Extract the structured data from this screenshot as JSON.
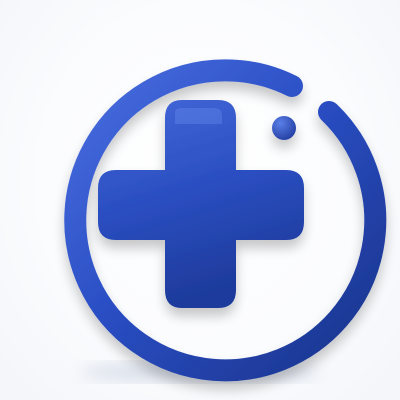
{
  "icon": {
    "name": "medical-plus-circle-icon",
    "colors": {
      "primary": "#2547b8",
      "highlight": "#4a6fe0",
      "shade": "#1a338a",
      "background": "#ffffff"
    }
  }
}
